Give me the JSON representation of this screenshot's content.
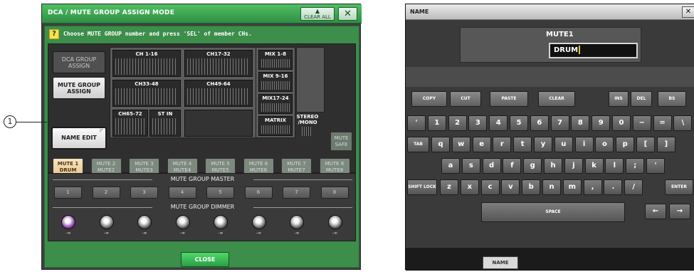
{
  "left_window": {
    "title": "DCA / MUTE GROUP ASSIGN MODE",
    "clear_all": "CLEAR ALL",
    "close_x": "✕",
    "instruction_icon": "?",
    "instruction": "Choose MUTE GROUP number and press 'SEL' of member CHs.",
    "dca_group_assign": "DCA GROUP ASSIGN",
    "mute_group_assign": "MUTE GROUP ASSIGN",
    "channel_blocks": [
      "CH 1-16",
      "CH17-32",
      "CH33-48",
      "CH49-64",
      "CH65-72",
      "ST IN"
    ],
    "mix_blocks": [
      "MIX 1-8",
      "MIX 9-16",
      "MIX17-24",
      "MATRIX"
    ],
    "stereo_mono": "STEREO /MONO",
    "name_edit": "NAME EDIT",
    "mute_safe": "MUTE SAFE",
    "mute_tabs": [
      {
        "line1": "MUTE 1",
        "line2": "DRUM"
      },
      {
        "line1": "MUTE 2",
        "line2": "MUTE2"
      },
      {
        "line1": "MUTE 3",
        "line2": "MUTE3"
      },
      {
        "line1": "MUTE 4",
        "line2": "MUTE4"
      },
      {
        "line1": "MUTE 5",
        "line2": "MUTE5"
      },
      {
        "line1": "MUTE 6",
        "line2": "MUTE6"
      },
      {
        "line1": "MUTE 7",
        "line2": "MUTE7"
      },
      {
        "line1": "MUTE 8",
        "line2": "MUTE8"
      }
    ],
    "active_tab": 0,
    "master_label": "MUTE GROUP MASTER",
    "master_buttons": [
      "1",
      "2",
      "3",
      "4",
      "5",
      "6",
      "7",
      "8"
    ],
    "dimmer_label": "MUTE GROUP DIMMER",
    "dimmer_values": [
      "-∞",
      "-∞",
      "-∞",
      "-∞",
      "-∞",
      "-∞",
      "-∞",
      "-∞"
    ],
    "close": "CLOSE",
    "callout": "1",
    "accent_color": "#3c8e4a"
  },
  "right_window": {
    "title": "NAME",
    "close_x": "✕",
    "mute_label": "MUTE1",
    "name_value": "DRUM",
    "fn_keys": [
      "COPY",
      "CUT",
      "PASTE",
      "CLEAR",
      "INS",
      "DEL",
      "BS"
    ],
    "row1": [
      "'",
      "1",
      "2",
      "3",
      "4",
      "5",
      "6",
      "7",
      "8",
      "9",
      "0",
      "−",
      "=",
      "\\"
    ],
    "row2": [
      "TAB",
      "q",
      "w",
      "e",
      "r",
      "t",
      "y",
      "u",
      "i",
      "o",
      "p",
      "[",
      "]"
    ],
    "row3": [
      "a",
      "s",
      "d",
      "f",
      "g",
      "h",
      "j",
      "k",
      "l",
      ";",
      "'"
    ],
    "row4": [
      "SHIFT LOCK",
      "z",
      "x",
      "c",
      "v",
      "b",
      "n",
      "m",
      ",",
      ".",
      "/",
      "ENTER"
    ],
    "space": "SPACE",
    "arrow_left": "←",
    "arrow_right": "→",
    "bottom_tab": "NAME"
  }
}
